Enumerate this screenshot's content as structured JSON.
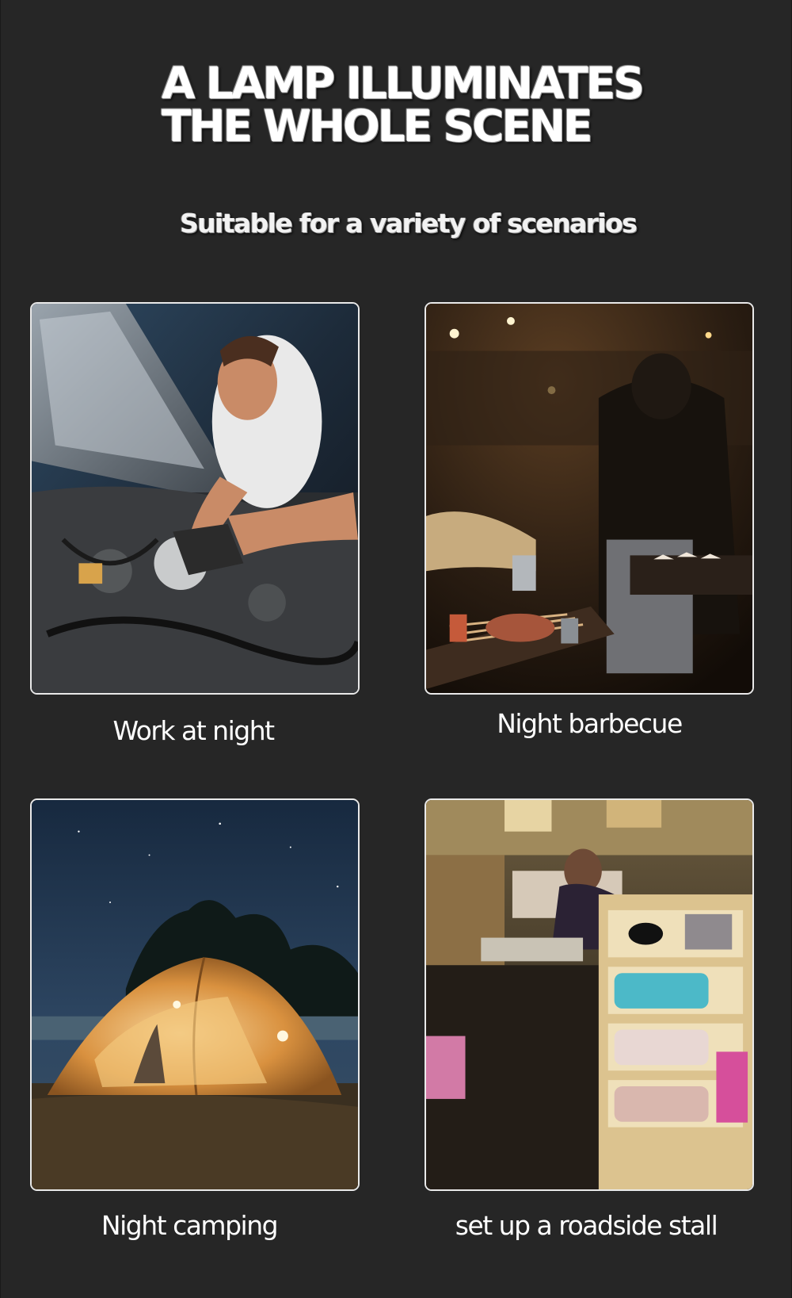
{
  "header": {
    "title_line1": "A LAMP ILLUMINATES",
    "title_line2": "THE WHOLE SCENE",
    "subtitle": "Suitable for a variety of scenarios"
  },
  "scenes": [
    {
      "caption": "Work at night",
      "photo": "mechanic-under-car-hood-photo"
    },
    {
      "caption": "Night barbecue",
      "photo": "night-barbecue-grill-photo"
    },
    {
      "caption": "Night camping",
      "photo": "lit-tent-under-night-sky-photo"
    },
    {
      "caption": "set up a roadside stall",
      "photo": "night-market-stall-photo"
    }
  ],
  "colors": {
    "background": "#262626",
    "text": "#ffffff",
    "card_border": "#e9e9e9"
  }
}
